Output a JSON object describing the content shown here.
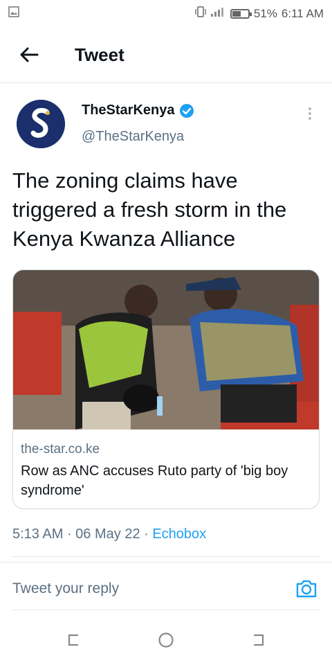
{
  "status_bar": {
    "battery": "51%",
    "time": "6:11 AM"
  },
  "header": {
    "title": "Tweet"
  },
  "author": {
    "display_name": "TheStarKenya",
    "handle": "@TheStarKenya"
  },
  "tweet": {
    "text": "The zoning claims have triggered a fresh storm in the Kenya Kwanza Alliance"
  },
  "card": {
    "domain": "the-star.co.ke",
    "title": "Row as ANC accuses Ruto party of 'big boy syndrome'"
  },
  "meta": {
    "time": "5:13 AM",
    "sep1": " · ",
    "date": "06 May 22",
    "sep2": " · ",
    "source": "Echobox"
  },
  "reply": {
    "placeholder": "Tweet your reply"
  },
  "colors": {
    "accent": "#1da1f2",
    "secondary_text": "#5b7083",
    "avatar_bg": "#1a2f6b"
  }
}
